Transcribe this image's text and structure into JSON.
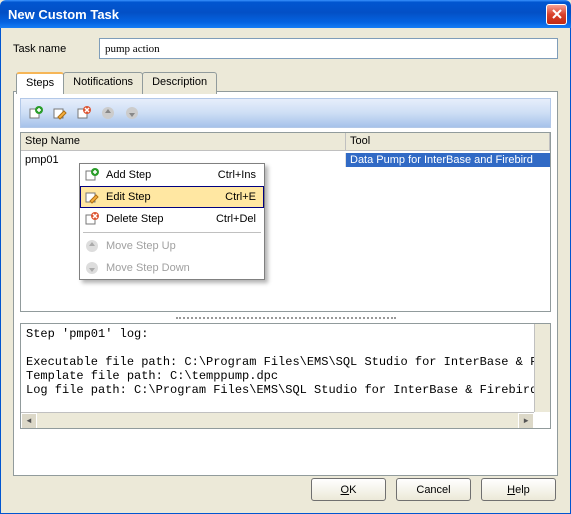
{
  "window": {
    "title": "New Custom Task"
  },
  "taskname": {
    "label": "Task name",
    "value": "pump action"
  },
  "tabs": [
    {
      "label": "Steps"
    },
    {
      "label": "Notifications"
    },
    {
      "label": "Description"
    }
  ],
  "grid": {
    "headers": {
      "step": "Step Name",
      "tool": "Tool"
    },
    "rows": [
      {
        "step": "pmp01",
        "tool": "Data Pump for InterBase and Firebird"
      }
    ]
  },
  "context_menu": {
    "add": {
      "label": "Add Step",
      "shortcut": "Ctrl+Ins"
    },
    "edit": {
      "label": "Edit Step",
      "shortcut": "Ctrl+E"
    },
    "delete": {
      "label": "Delete Step",
      "shortcut": "Ctrl+Del"
    },
    "moveup": {
      "label": "Move Step Up"
    },
    "movedown": {
      "label": "Move Step Down"
    }
  },
  "log": {
    "line1": "Step 'pmp01' log:",
    "line2": "Executable file path: C:\\Program Files\\EMS\\SQL Studio for InterBase & Fi",
    "line3": "Template file path: C:\\temppump.dpc",
    "line4": "Log file path: C:\\Program Files\\EMS\\SQL Studio for InterBase & Firebird\\"
  },
  "buttons": {
    "ok": "OK",
    "cancel": "Cancel",
    "help": "Help"
  }
}
